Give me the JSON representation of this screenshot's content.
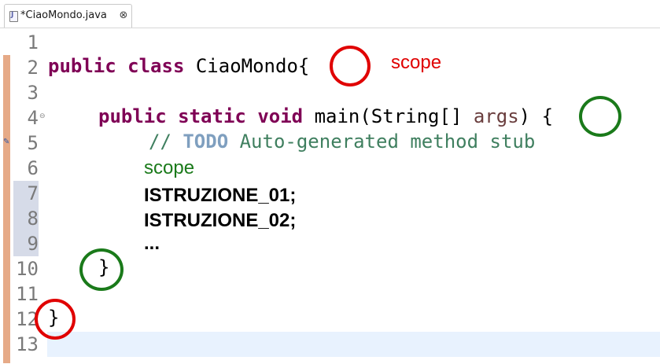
{
  "tab": {
    "label": "*CiaoMondo.java",
    "close_glyph": "⊗",
    "icon": "java-file-icon"
  },
  "lines": [
    "1",
    "2",
    "3",
    "4",
    "5",
    "6",
    "7",
    "8",
    "9",
    "10",
    "11",
    "12",
    "13"
  ],
  "code": {
    "line2": {
      "kw1": "public",
      "kw2": "class",
      "name": "CiaoMondo",
      "brace": "{"
    },
    "line4": {
      "kw1": "public",
      "kw2": "static",
      "kw3": "void",
      "rest": "main(String[]",
      "param": "args",
      "close": ")",
      "brace": "{"
    },
    "line5": {
      "comment_start": "// ",
      "todo": "TODO",
      "comment_rest": " Auto-generated method stub"
    },
    "line10": {
      "brace": "}"
    },
    "line12": {
      "brace": "}"
    }
  },
  "annotations": {
    "scope_class": "scope",
    "scope_method": "scope",
    "stmt1": "ISTRUZIONE_01;",
    "stmt2": "ISTRUZIONE_02;",
    "ellipsis": "..."
  },
  "colors": {
    "keyword": "#7f0055",
    "comment": "#3f7f5f",
    "todo": "#7f9fbf",
    "red_annotation": "#e00000",
    "green_annotation": "#1a7a1a",
    "current_line": "#e8f2fe"
  }
}
